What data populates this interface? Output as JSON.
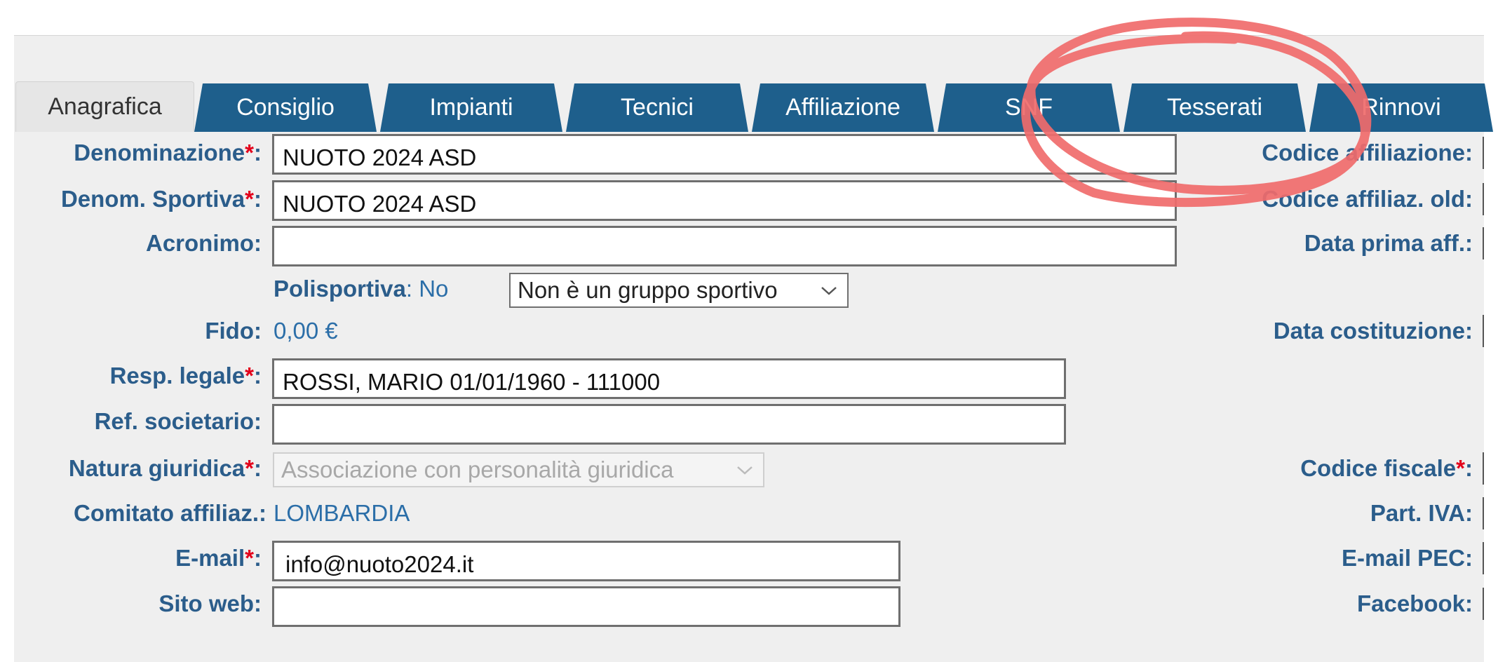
{
  "tabs": [
    {
      "label": "Anagrafica",
      "active": true
    },
    {
      "label": "Consiglio"
    },
    {
      "label": "Impianti"
    },
    {
      "label": "Tecnici"
    },
    {
      "label": "Affiliazione"
    },
    {
      "label": "SNF"
    },
    {
      "label": "Tesserati"
    },
    {
      "label": "Rinnovi"
    }
  ],
  "required_mark": "*",
  "colon": ":",
  "form": {
    "denominazione": {
      "label": "Denominazione",
      "value": "NUOTO 2024 ASD"
    },
    "denom_sportiva": {
      "label": "Denom. Sportiva",
      "value": "NUOTO 2024 ASD"
    },
    "acronimo": {
      "label": "Acronimo:",
      "value": ""
    },
    "polisportiva": {
      "label": "Polisportiva",
      "value": ": No",
      "select": "Non è un gruppo sportivo"
    },
    "fido": {
      "label": "Fido:",
      "value": "0,00 €"
    },
    "resp_legale": {
      "label": "Resp. legale",
      "value": "ROSSI, MARIO 01/01/1960 - 111000"
    },
    "ref_societario": {
      "label": "Ref. societario:",
      "value": ""
    },
    "natura_giuridica": {
      "label": "Natura giuridica",
      "value": "Associazione con personalità giuridica"
    },
    "comitato": {
      "label": "Comitato affiliaz.:",
      "value": "LOMBARDIA"
    },
    "email": {
      "label": "E-mail",
      "value": "info@nuoto2024.it"
    },
    "sito_web": {
      "label": "Sito web:",
      "value": ""
    }
  },
  "right_labels": {
    "codice_affiliazione": "Codice affiliazione:",
    "codice_affiliaz_old": "Codice affiliaz. old:",
    "data_prima_aff": "Data prima aff.:",
    "data_costituzione": "Data costituzione:",
    "codice_fiscale": "Codice fiscale",
    "part_iva": "Part. IVA:",
    "email_pec": "E-mail PEC:",
    "facebook": "Facebook:"
  },
  "colors": {
    "tab": "#1e5f8c",
    "label": "#2b5d8b",
    "value": "#2b6ea8",
    "required": "#e3001b",
    "highlight": "#f06b6b"
  }
}
